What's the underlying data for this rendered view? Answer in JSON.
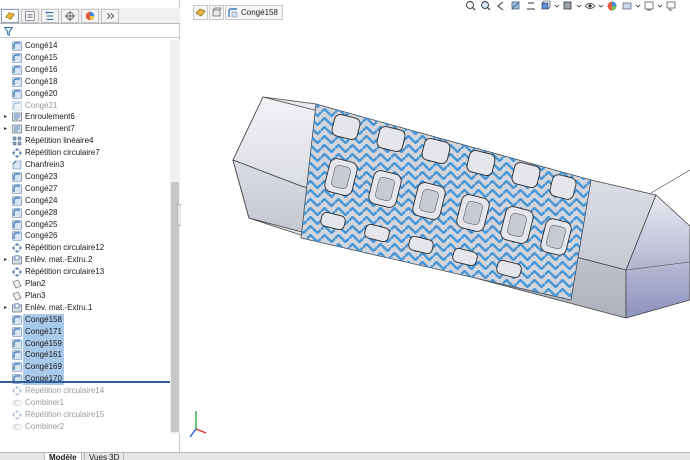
{
  "window": {
    "active_tab": "Modèle"
  },
  "property_manager_tabs": [
    {
      "name": "feature-manager-tab-icon",
      "active": true
    },
    {
      "name": "property-manager-tab-icon",
      "active": false
    },
    {
      "name": "configuration-manager-tab-icon",
      "active": false
    },
    {
      "name": "dimxpert-tab-icon",
      "active": false
    },
    {
      "name": "display-manager-tab-icon",
      "active": false
    },
    {
      "name": "more-tabs-icon",
      "active": false
    }
  ],
  "tree": {
    "items": [
      {
        "label": "Congé14",
        "type": "fillet",
        "state": "normal",
        "expandable": false
      },
      {
        "label": "Congé15",
        "type": "fillet",
        "state": "normal",
        "expandable": false
      },
      {
        "label": "Congé16",
        "type": "fillet",
        "state": "normal",
        "expandable": false
      },
      {
        "label": "Congé18",
        "type": "fillet",
        "state": "normal",
        "expandable": false
      },
      {
        "label": "Congé20",
        "type": "fillet",
        "state": "normal",
        "expandable": false
      },
      {
        "label": "Congé21",
        "type": "fillet",
        "state": "suppressed",
        "expandable": false
      },
      {
        "label": "Enroulement6",
        "type": "wrap",
        "state": "normal",
        "expandable": true
      },
      {
        "label": "Enroulement7",
        "type": "wrap",
        "state": "normal",
        "expandable": true
      },
      {
        "label": "Répétition linéaire4",
        "type": "linear-pattern",
        "state": "normal",
        "expandable": false
      },
      {
        "label": "Répétition circulaire7",
        "type": "circular-pattern",
        "state": "normal",
        "expandable": false
      },
      {
        "label": "Chanfrein3",
        "type": "chamfer",
        "state": "normal",
        "expandable": false
      },
      {
        "label": "Congé23",
        "type": "fillet",
        "state": "normal",
        "expandable": false
      },
      {
        "label": "Congé27",
        "type": "fillet",
        "state": "normal",
        "expandable": false
      },
      {
        "label": "Congé24",
        "type": "fillet",
        "state": "normal",
        "expandable": false
      },
      {
        "label": "Congé28",
        "type": "fillet",
        "state": "normal",
        "expandable": false
      },
      {
        "label": "Congé25",
        "type": "fillet",
        "state": "normal",
        "expandable": false
      },
      {
        "label": "Congé26",
        "type": "fillet",
        "state": "normal",
        "expandable": false
      },
      {
        "label": "Répétition circulaire12",
        "type": "circular-pattern",
        "state": "normal",
        "expandable": false
      },
      {
        "label": "Enlèv. mat.-Extru.2",
        "type": "cut-extrude",
        "state": "normal",
        "expandable": true
      },
      {
        "label": "Répétition circulaire13",
        "type": "circular-pattern",
        "state": "normal",
        "expandable": false
      },
      {
        "label": "Plan2",
        "type": "plane",
        "state": "normal",
        "expandable": false
      },
      {
        "label": "Plan3",
        "type": "plane",
        "state": "normal",
        "expandable": false
      },
      {
        "label": "Enlèv. mat.-Extru.1",
        "type": "cut-extrude",
        "state": "normal",
        "expandable": true
      },
      {
        "label": "Congé158",
        "type": "fillet",
        "state": "selected",
        "expandable": false
      },
      {
        "label": "Congé171",
        "type": "fillet",
        "state": "selected",
        "expandable": false
      },
      {
        "label": "Congé159",
        "type": "fillet",
        "state": "selected",
        "expandable": false
      },
      {
        "label": "Congé161",
        "type": "fillet",
        "state": "selected",
        "expandable": false
      },
      {
        "label": "Congé169",
        "type": "fillet",
        "state": "selected",
        "expandable": false
      },
      {
        "label": "Congé170",
        "type": "fillet",
        "state": "selected",
        "expandable": false
      },
      {
        "label": "Répétition circulaire14",
        "type": "circular-pattern",
        "state": "suppressed",
        "expandable": false
      },
      {
        "label": "Combiner1",
        "type": "combine",
        "state": "suppressed",
        "expandable": false
      },
      {
        "label": "Répétition circulaire15",
        "type": "circular-pattern",
        "state": "suppressed",
        "expandable": false
      },
      {
        "label": "Combiner2",
        "type": "combine",
        "state": "suppressed",
        "expandable": false
      }
    ]
  },
  "breadcrumb": {
    "items": [
      {
        "name": "part-breadcrumb-icon"
      },
      {
        "name": "feature-breadcrumb-icon"
      }
    ],
    "current_label": "Congé158"
  },
  "heads_up_toolbar": [
    "zoom-to-fit-icon",
    "zoom-to-area-icon",
    "previous-view-icon",
    "section-view-icon",
    "dynamic-annotation-icon",
    "view-orientation-icon",
    "display-style-icon",
    "hide-show-items-icon",
    "edit-appearance-icon",
    "apply-scene-icon",
    "view-settings-icon",
    "monitor-icon"
  ],
  "bottom_tabs": [
    {
      "label": "Modèle",
      "active": true
    },
    {
      "label": "Vues 3D",
      "active": false
    }
  ],
  "colors": {
    "selection": "#a9c9ea",
    "rollback": "#2f5f9e",
    "model_body": "#c9cdd6",
    "model_highlight": "#3a8fd6",
    "model_end_face": "#9ea0c8"
  }
}
